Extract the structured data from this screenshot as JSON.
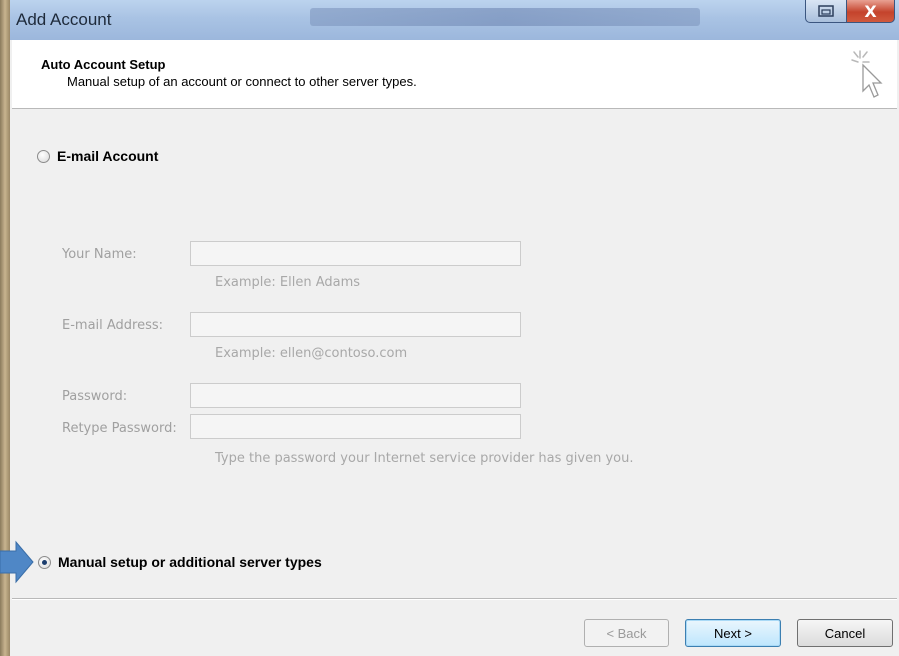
{
  "window": {
    "title": "Add Account",
    "close_glyph": "X"
  },
  "header": {
    "title": "Auto Account Setup",
    "subtitle": "Manual setup of an account or connect to other server types."
  },
  "options": {
    "email_account": {
      "label": "E-mail Account",
      "selected": false
    },
    "manual_setup": {
      "label": "Manual setup or additional server types",
      "selected": true
    }
  },
  "form": {
    "your_name": {
      "label": "Your Name:",
      "value": "",
      "hint": "Example: Ellen Adams"
    },
    "email_address": {
      "label": "E-mail Address:",
      "value": "",
      "hint": "Example: ellen@contoso.com"
    },
    "password": {
      "label": "Password:",
      "value": ""
    },
    "retype_password": {
      "label": "Retype Password:",
      "value": "",
      "hint": "Type the password your Internet service provider has given you."
    }
  },
  "buttons": {
    "back": "< Back",
    "next": "Next >",
    "cancel": "Cancel"
  },
  "colors": {
    "accent_blue": "#3c7fb1",
    "pointer_arrow": "#4f87c6",
    "disabled_text": "#a0a0a0"
  }
}
